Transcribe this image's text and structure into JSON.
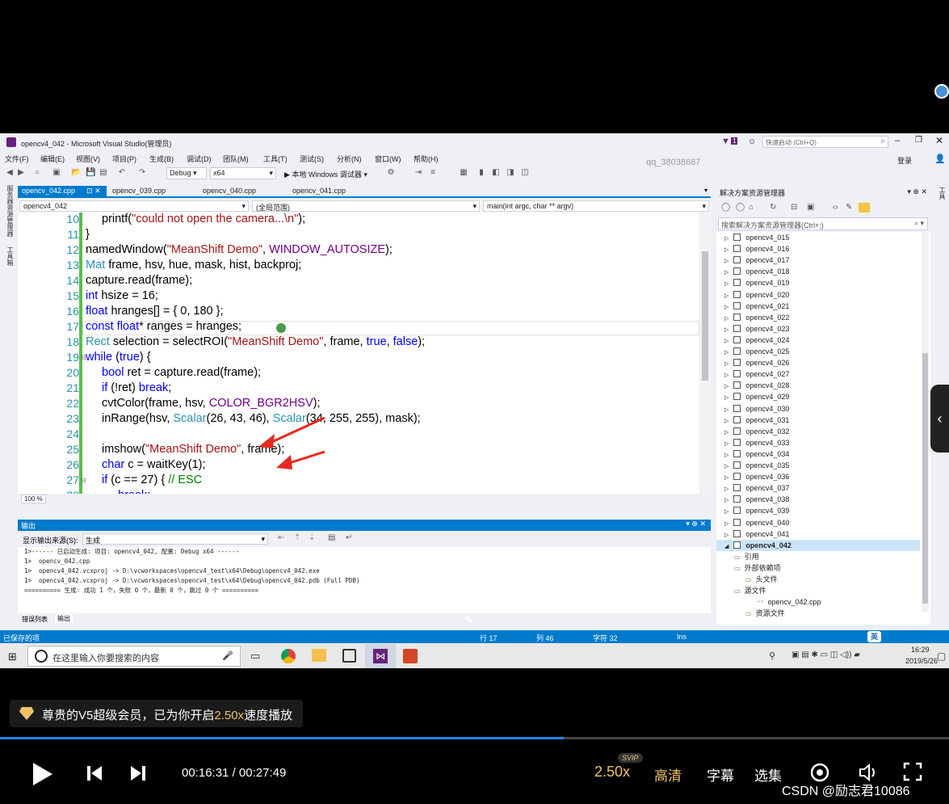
{
  "window": {
    "title": "opencv4_042 - Microsoft Visual Studio(管理员)",
    "quick_launch_placeholder": "快速启动 (Ctrl+Q)",
    "watermark_user": "qq_38038687",
    "login_label": "登录",
    "notification_count": "1"
  },
  "menu": [
    "文件(F)",
    "编辑(E)",
    "视图(V)",
    "项目(P)",
    "生成(B)",
    "调试(D)",
    "团队(M)",
    "工具(T)",
    "测试(S)",
    "分析(N)",
    "窗口(W)",
    "帮助(H)"
  ],
  "toolbar": {
    "config": "Debug",
    "platform": "x64",
    "run_label": "▶ 本地 Windows 调试器 ▾"
  },
  "tabs": [
    "opencv_042.cpp",
    "opencv_039.cpp",
    "opencv_040.cpp",
    "opencv_041.cpp"
  ],
  "nav": {
    "project": "opencv4_042",
    "scope": "(全局范围)",
    "function": "main(int argc, char ** argv)"
  },
  "editor": {
    "zoom": "100 %",
    "lines": [
      {
        "n": "10",
        "indent": 2
      },
      {
        "n": "11",
        "indent": 1
      },
      {
        "n": "12",
        "indent": 1
      },
      {
        "n": "13",
        "indent": 1
      },
      {
        "n": "14",
        "indent": 1
      },
      {
        "n": "15",
        "indent": 1
      },
      {
        "n": "16",
        "indent": 1
      },
      {
        "n": "17",
        "indent": 1
      },
      {
        "n": "18",
        "indent": 1
      },
      {
        "n": "19",
        "indent": 1
      },
      {
        "n": "20",
        "indent": 2
      },
      {
        "n": "21",
        "indent": 2
      },
      {
        "n": "22",
        "indent": 2
      },
      {
        "n": "23",
        "indent": 2
      },
      {
        "n": "24",
        "indent": 2
      },
      {
        "n": "25",
        "indent": 2
      },
      {
        "n": "26",
        "indent": 2
      },
      {
        "n": "27",
        "indent": 2
      },
      {
        "n": "28",
        "indent": 3
      }
    ]
  },
  "output": {
    "header": "输出",
    "source_label": "显示输出来源(S):",
    "source_value": "生成",
    "lines": [
      "1>------ 已启动生成: 项目: opencv4_042, 配置: Debug x64 ------",
      "1>  opencv_042.cpp",
      "1>  opencv4_042.vcxproj -> D:\\vcworkspaces\\opencv4_test\\x64\\Debug\\opencv4_042.exe",
      "1>  opencv4_042.vcxproj -> D:\\vcworkspaces\\opencv4_test\\x64\\Debug\\opencv4_042.pdb (Full PDB)",
      "========== 生成: 成功 1 个，失败 0 个，最新 0 个，跳过 0 个 =========="
    ],
    "tabs": [
      "错误列表",
      "输出"
    ]
  },
  "solution_explorer": {
    "title": "解决方案资源管理器",
    "search_placeholder": "搜索解决方案资源管理器(Ctrl+;)",
    "projects": [
      "opencv4_015",
      "opencv4_016",
      "opencv4_017",
      "opencv4_018",
      "opencv4_019",
      "opencv4_020",
      "opencv4_021",
      "opencv4_022",
      "opencv4_023",
      "opencv4_024",
      "opencv4_025",
      "opencv4_026",
      "opencv4_027",
      "opencv4_028",
      "opencv4_029",
      "opencv4_030",
      "opencv4_031",
      "opencv4_032",
      "opencv4_033",
      "opencv4_034",
      "opencv4_035",
      "opencv4_036",
      "opencv4_037",
      "opencv4_038",
      "opencv4_039",
      "opencv4_040",
      "opencv4_041",
      "opencv4_042"
    ],
    "children": [
      "引用",
      "外部依赖项",
      "头文件",
      "源文件",
      "opencv_042.cpp",
      "资源文件"
    ]
  },
  "side_tabs": {
    "left1": "服务器资源管理器",
    "left2": "工具箱",
    "right": "工具"
  },
  "status": {
    "left": "已保存的项",
    "row": "行 17",
    "col": "列 46",
    "char": "字符 32",
    "mode": "Ins",
    "ime": "英"
  },
  "taskbar": {
    "search_placeholder": "在这里输入你要搜索的内容",
    "time": "16:29",
    "date": "2019/5/26"
  },
  "player": {
    "vip_text_prefix": "尊贵的V5超级会员，已为你开启",
    "vip_speed": "2.50x",
    "vip_text_suffix": "速度播放",
    "current_time": "00:16:31",
    "separator": " / ",
    "total_time": "00:27:49",
    "progress": 0.594,
    "speed": "2.50x",
    "badge": "SVIP",
    "quality": "高清",
    "subtitle": "字幕",
    "episodes": "选集",
    "watermark": "CSDN @励志君10086",
    "accent": "#f0c26a"
  }
}
